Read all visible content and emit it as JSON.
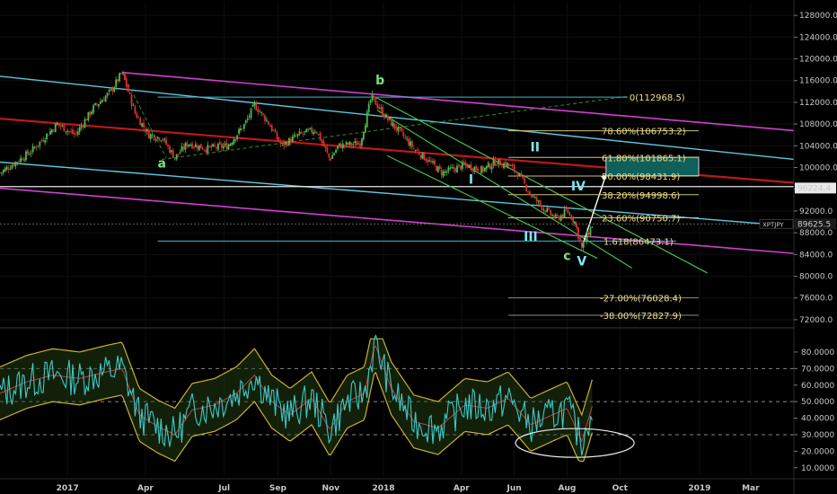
{
  "chart_data": [
    {
      "type": "candlestick",
      "title": "",
      "symbol_tag": "XPTJPY",
      "last_price": 89625.5,
      "last_price_label": "89625.5",
      "ref_price": 96224.4,
      "ref_price_label": "96224.4",
      "ylim": [
        71000,
        130500
      ],
      "y_ticks": [
        {
          "value": 128000,
          "label": "128000.0"
        },
        {
          "value": 124000,
          "label": "124000.0"
        },
        {
          "value": 120000,
          "label": "120000.0"
        },
        {
          "value": 116000,
          "label": "116000.0"
        },
        {
          "value": 112000,
          "label": "112000.0"
        },
        {
          "value": 108000,
          "label": "108000.0"
        },
        {
          "value": 104000,
          "label": "104000.0"
        },
        {
          "value": 100000,
          "label": "100000.0"
        },
        {
          "value": 96000,
          "label": "96000.0"
        },
        {
          "value": 92000,
          "label": "92000.0"
        },
        {
          "value": 88000,
          "label": "88000.0"
        },
        {
          "value": 84000,
          "label": "84000.0"
        },
        {
          "value": 80000,
          "label": "80000.0"
        },
        {
          "value": 76000,
          "label": "76000.0"
        },
        {
          "value": 72000,
          "label": "72000.0"
        }
      ],
      "x_ticks": [
        {
          "date": "2017-01-01",
          "label": "2017"
        },
        {
          "date": "2017-04-01",
          "label": "Apr"
        },
        {
          "date": "2017-07-01",
          "label": "Jul"
        },
        {
          "date": "2017-09-01",
          "label": "Sep"
        },
        {
          "date": "2017-11-01",
          "label": "Nov"
        },
        {
          "date": "2018-01-01",
          "label": "2018"
        },
        {
          "date": "2018-04-01",
          "label": "Apr"
        },
        {
          "date": "2018-06-01",
          "label": "Jun"
        },
        {
          "date": "2018-08-01",
          "label": "Aug"
        },
        {
          "date": "2018-10-01",
          "label": "Oct"
        },
        {
          "date": "2019-01-01",
          "label": "2019"
        },
        {
          "date": "2019-03-01",
          "label": "Mar"
        }
      ],
      "price_path": [
        [
          "2016-10-15",
          99000
        ],
        [
          "2016-11-20",
          103000
        ],
        [
          "2016-12-20",
          108000
        ],
        [
          "2017-01-10",
          106000
        ],
        [
          "2017-01-31",
          111000
        ],
        [
          "2017-02-20",
          114000
        ],
        [
          "2017-03-05",
          117500
        ],
        [
          "2017-03-20",
          110000
        ],
        [
          "2017-04-05",
          106000
        ],
        [
          "2017-04-20",
          105500
        ],
        [
          "2017-05-05",
          101800
        ],
        [
          "2017-05-20",
          104500
        ],
        [
          "2017-06-10",
          103500
        ],
        [
          "2017-07-05",
          104000
        ],
        [
          "2017-07-25",
          108000
        ],
        [
          "2017-08-05",
          111500
        ],
        [
          "2017-08-20",
          108500
        ],
        [
          "2017-09-05",
          104000
        ],
        [
          "2017-09-25",
          106000
        ],
        [
          "2017-10-15",
          107000
        ],
        [
          "2017-10-31",
          101500
        ],
        [
          "2017-11-10",
          104000
        ],
        [
          "2017-12-05",
          104500
        ],
        [
          "2017-12-18",
          113000
        ],
        [
          "2018-01-05",
          109000
        ],
        [
          "2018-01-20",
          106500
        ],
        [
          "2018-02-05",
          103500
        ],
        [
          "2018-02-20",
          101500
        ],
        [
          "2018-03-10",
          99000
        ],
        [
          "2018-04-05",
          100500
        ],
        [
          "2018-04-25",
          99500
        ],
        [
          "2018-05-10",
          101000
        ],
        [
          "2018-05-25",
          100500
        ],
        [
          "2018-06-05",
          99000
        ],
        [
          "2018-06-20",
          95000
        ],
        [
          "2018-07-05",
          92500
        ],
        [
          "2018-07-20",
          90500
        ],
        [
          "2018-08-01",
          92000
        ],
        [
          "2018-08-10",
          90000
        ],
        [
          "2018-08-18",
          85000
        ],
        [
          "2018-08-24",
          87500
        ],
        [
          "2018-08-31",
          89625
        ]
      ],
      "fib_levels": [
        {
          "label": "0(112968.5)",
          "value": 112968.5
        },
        {
          "label": "78.60%(106753.2)",
          "value": 106753.2
        },
        {
          "label": "61.80%(101865.1)",
          "value": 101865.1
        },
        {
          "label": "50.00%(98431.9)",
          "value": 98431.9
        },
        {
          "label": "38.20%(94998.6)",
          "value": 94998.6
        },
        {
          "label": "23.60%(90750.7)",
          "value": 90750.7
        },
        {
          "label": "1.618(86473.1)",
          "value": 86473.1
        },
        {
          "label": "-27.00%(76028.4)",
          "value": 76028.4
        },
        {
          "label": "-38.00%(72827.9)",
          "value": 72827.9
        }
      ],
      "wave_labels": [
        {
          "text": "a",
          "date": "2017-04-20",
          "value": 100000,
          "color": "#7ee07e"
        },
        {
          "text": "b",
          "date": "2017-12-28",
          "value": 115300,
          "color": "#7ee07e"
        },
        {
          "text": "c",
          "date": "2018-08-01",
          "value": 83000,
          "color": "#7ee07e"
        },
        {
          "text": "I",
          "date": "2018-04-12",
          "value": 97000,
          "color": "#7fe6f0"
        },
        {
          "text": "II",
          "date": "2018-06-25",
          "value": 103000,
          "color": "#7fe6f0"
        },
        {
          "text": "III",
          "date": "2018-06-20",
          "value": 86500,
          "color": "#7fe6f0"
        },
        {
          "text": "IV",
          "date": "2018-08-14",
          "value": 95800,
          "color": "#7fe6f0"
        },
        {
          "text": "V",
          "date": "2018-08-18",
          "value": 82000,
          "color": "#7fe6f0"
        }
      ]
    },
    {
      "type": "line",
      "title": "",
      "ylim": [
        5,
        93
      ],
      "y_ticks": [
        {
          "value": 80,
          "label": "80.0000"
        },
        {
          "value": 70,
          "label": "70.0000"
        },
        {
          "value": 60,
          "label": "60.0000"
        },
        {
          "value": 50,
          "label": "50.0000"
        },
        {
          "value": 40,
          "label": "40.0000"
        },
        {
          "value": 30,
          "label": "30.0000"
        },
        {
          "value": 20,
          "label": "20.0000"
        },
        {
          "value": 10,
          "label": "10.0000"
        }
      ],
      "reference_levels": [
        70,
        50,
        30
      ],
      "rsi_path": [
        [
          "2016-10-15",
          55
        ],
        [
          "2016-11-15",
          62
        ],
        [
          "2016-12-15",
          66
        ],
        [
          "2017-01-15",
          64
        ],
        [
          "2017-02-15",
          68
        ],
        [
          "2017-03-05",
          70
        ],
        [
          "2017-03-25",
          42
        ],
        [
          "2017-04-15",
          35
        ],
        [
          "2017-05-05",
          30
        ],
        [
          "2017-05-25",
          45
        ],
        [
          "2017-06-20",
          48
        ],
        [
          "2017-07-15",
          55
        ],
        [
          "2017-08-05",
          66
        ],
        [
          "2017-08-25",
          50
        ],
        [
          "2017-09-15",
          42
        ],
        [
          "2017-10-10",
          52
        ],
        [
          "2017-10-31",
          33
        ],
        [
          "2017-11-20",
          50
        ],
        [
          "2017-12-10",
          55
        ],
        [
          "2017-12-22",
          85
        ],
        [
          "2018-01-10",
          58
        ],
        [
          "2018-02-05",
          38
        ],
        [
          "2018-03-05",
          34
        ],
        [
          "2018-04-05",
          48
        ],
        [
          "2018-05-01",
          46
        ],
        [
          "2018-05-25",
          52
        ],
        [
          "2018-06-20",
          36
        ],
        [
          "2018-07-15",
          42
        ],
        [
          "2018-08-01",
          46
        ],
        [
          "2018-08-18",
          26
        ],
        [
          "2018-08-31",
          49
        ]
      ]
    }
  ]
}
